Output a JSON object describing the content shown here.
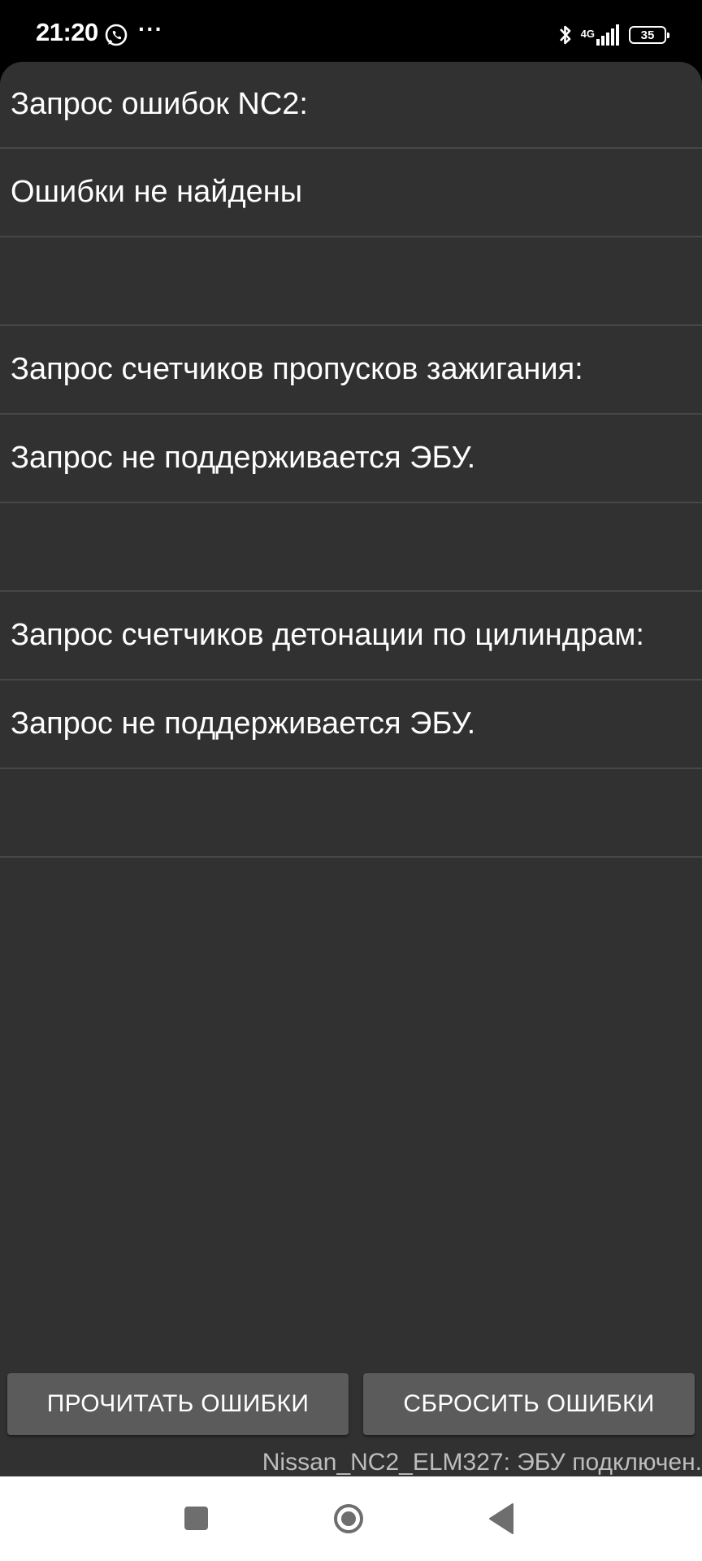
{
  "status_bar": {
    "time": "21:20",
    "dots": "···",
    "network": "4G",
    "battery": "35"
  },
  "rows": [
    "Запрос ошибок NC2:",
    "Ошибки не найдены",
    "",
    "Запрос счетчиков пропусков зажигания:",
    "Запрос не поддерживается ЭБУ.",
    "",
    "Запрос счетчиков детонации по цилиндрам:",
    "Запрос не поддерживается ЭБУ.",
    ""
  ],
  "buttons": {
    "read_label": "ПРОЧИТАТЬ ОШИБКИ",
    "reset_label": "СБРОСИТЬ ОШИБКИ"
  },
  "connection_status": "Nissan_NC2_ELM327: ЭБУ подключен.",
  "colors": {
    "background": "#313131",
    "button": "#5b5b5b",
    "divider": "#474747"
  }
}
